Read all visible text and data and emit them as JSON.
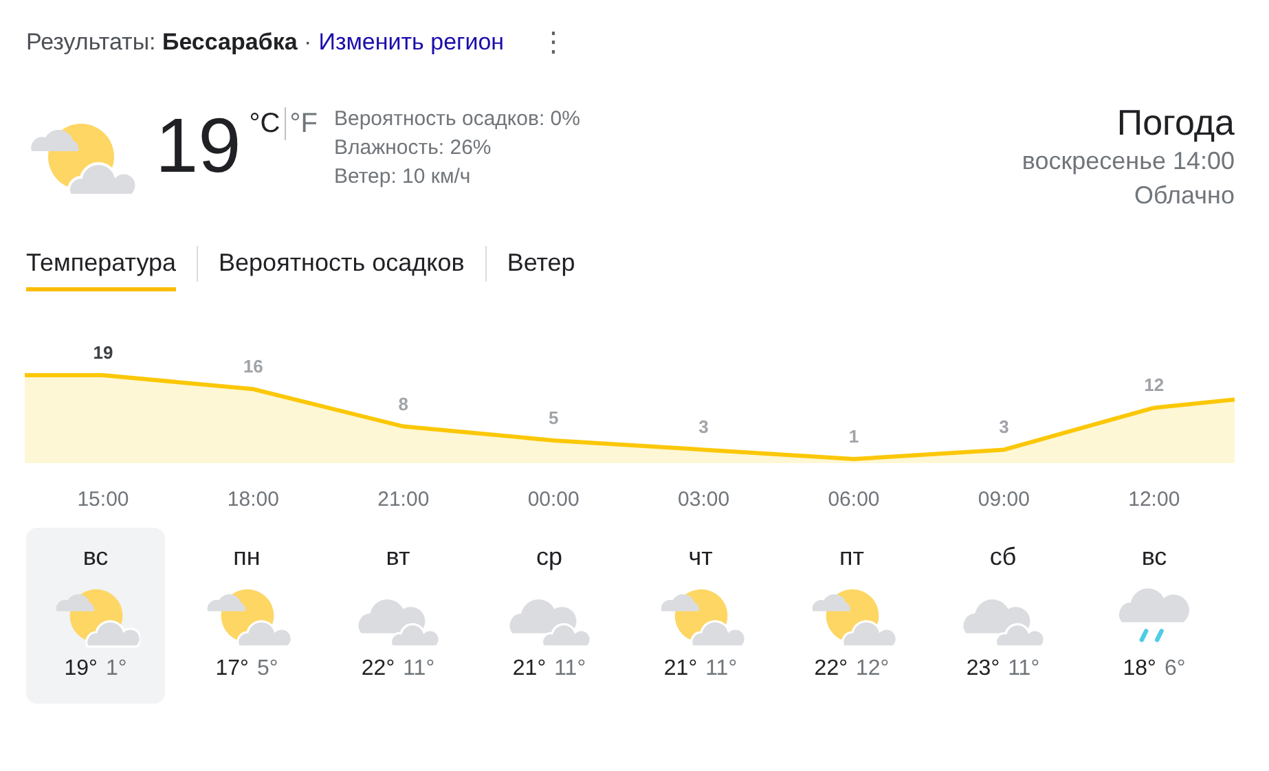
{
  "header": {
    "prefix": "Результаты:",
    "location": "Бессарабка",
    "separator": "·",
    "change_link": "Изменить регион",
    "menu": "⋮"
  },
  "current": {
    "kind": "partly_cloudy",
    "temperature": "19",
    "units": [
      {
        "label": "°C",
        "selected": true
      },
      {
        "label": "°F",
        "selected": false
      }
    ],
    "details": [
      "Вероятность осадков: 0%",
      "Влажность: 26%",
      "Ветер: 10 км/ч"
    ],
    "title": "Погода",
    "time": "воскресенье 14:00",
    "condition": "Облачно"
  },
  "tabs": [
    {
      "label": "Температура",
      "selected": true
    },
    {
      "label": "Вероятность осадков",
      "selected": false
    },
    {
      "label": "Ветер",
      "selected": false
    }
  ],
  "chart_data": {
    "type": "area",
    "categories": [
      "15:00",
      "18:00",
      "21:00",
      "00:00",
      "03:00",
      "06:00",
      "09:00",
      "12:00"
    ],
    "values": [
      19,
      16,
      8,
      5,
      3,
      1,
      3,
      12
    ],
    "data_labels": true
  },
  "days": [
    {
      "day": "вс",
      "kind": "partly_cloudy",
      "high": "19°",
      "low": "1°",
      "selected": true
    },
    {
      "day": "пн",
      "kind": "partly_cloudy",
      "high": "17°",
      "low": "5°",
      "selected": false
    },
    {
      "day": "вт",
      "kind": "cloudy",
      "high": "22°",
      "low": "11°",
      "selected": false
    },
    {
      "day": "ср",
      "kind": "cloudy",
      "high": "21°",
      "low": "11°",
      "selected": false
    },
    {
      "day": "чт",
      "kind": "partly_cloudy",
      "high": "21°",
      "low": "11°",
      "selected": false
    },
    {
      "day": "пт",
      "kind": "partly_cloudy",
      "high": "22°",
      "low": "12°",
      "selected": false
    },
    {
      "day": "сб",
      "kind": "cloudy",
      "high": "23°",
      "low": "11°",
      "selected": false
    },
    {
      "day": "вс",
      "kind": "rain",
      "high": "18°",
      "low": "6°",
      "selected": false
    }
  ]
}
